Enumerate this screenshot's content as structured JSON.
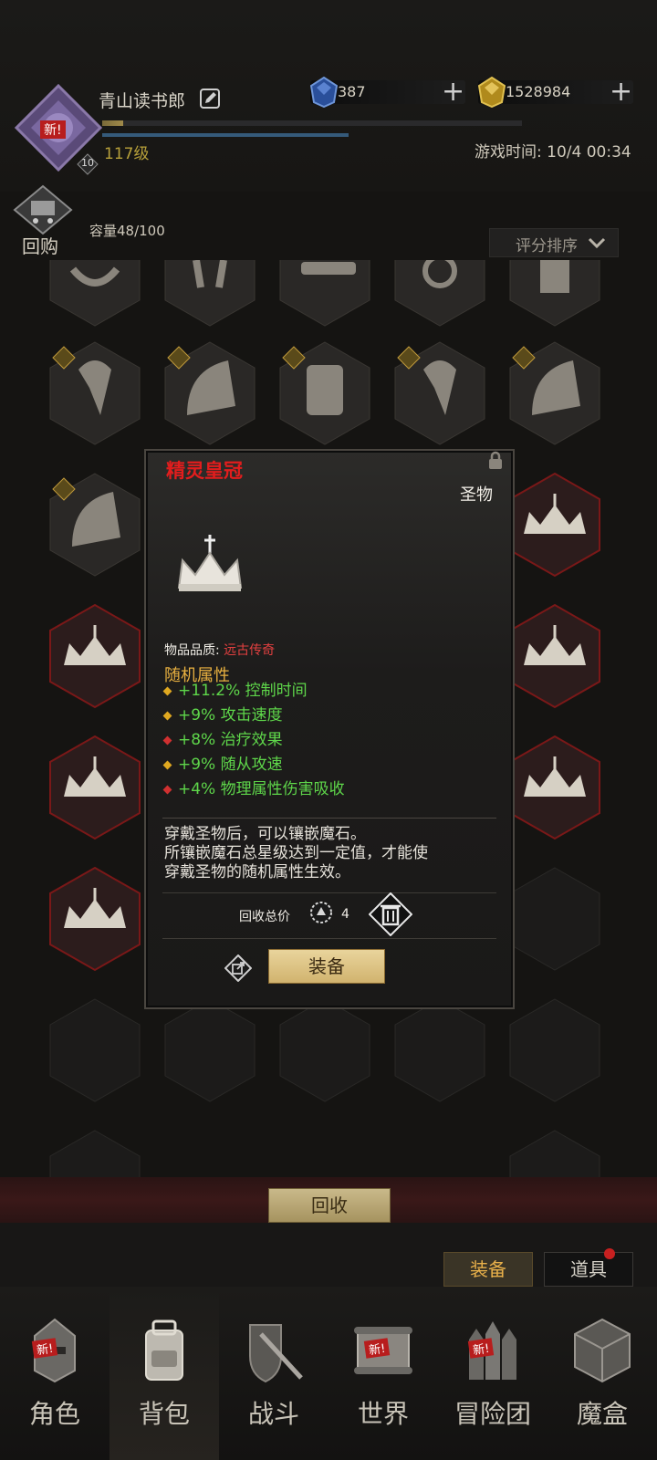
{
  "header": {
    "player_name": "青山读书郎",
    "level": "117级",
    "level_badge": "10",
    "avatar_badge": "新!",
    "gems": "387",
    "gold": "1528984",
    "game_time": "游戏时间: 10/4 00:34",
    "exp_progress": 0.05
  },
  "inventory": {
    "recycle_label": "回购",
    "capacity": "容量48/100",
    "sort_label": "评分排序"
  },
  "popup": {
    "name": "精灵皇冠",
    "type": "圣物",
    "quality_label": "物品品质:",
    "quality_value": "远古传奇",
    "random_title": "随机属性",
    "attributes": [
      {
        "text": "+11.2% 控制时间",
        "dot": "gold"
      },
      {
        "text": "+9% 攻击速度",
        "dot": "gold"
      },
      {
        "text": "+8% 治疗效果",
        "dot": "red"
      },
      {
        "text": "+9% 随从攻速",
        "dot": "gold"
      },
      {
        "text": "+4% 物理属性伤害吸收",
        "dot": "red"
      }
    ],
    "desc_line1": "穿戴圣物后，可以镶嵌魔石。",
    "desc_line2": "所镶嵌魔石总星级达到一定值，才能使",
    "desc_line3": "穿戴圣物的随机属性生效。",
    "recycle_price_label": "回收总价",
    "recycle_price": "4",
    "equip_label": "装备"
  },
  "bottom": {
    "recycle_all": "回收",
    "subtab_equip": "装备",
    "subtab_items": "道具"
  },
  "nav": {
    "role": "角色",
    "bag": "背包",
    "battle": "战斗",
    "world": "世界",
    "adventure": "冒险团",
    "magic_box": "魔盒",
    "new": "新!"
  },
  "colors": {
    "legendary_red": "#e21d1d",
    "attr_green": "#5ed64a",
    "title_gold": "#e8b040"
  }
}
